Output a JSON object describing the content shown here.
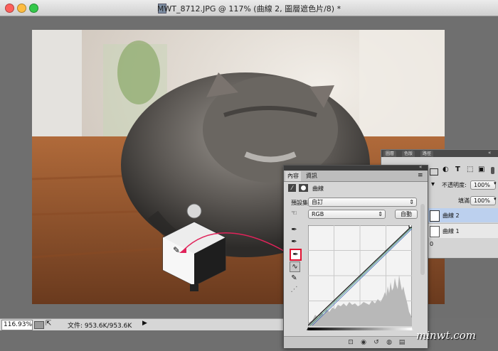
{
  "window": {
    "title": "MWT_8712.JPG @ 117% (曲線 2, 圖層遮色片/8) *"
  },
  "statusbar": {
    "zoom": "116.93%",
    "doc_info": "文件: 953.6K/953.6K"
  },
  "layers_panel": {
    "tabs": [
      "圖層",
      "色版",
      "路徑"
    ],
    "opacity_label": "不透明度:",
    "opacity_value": "100%",
    "fill_label": "填滿:",
    "fill_value": "100%",
    "layers": [
      {
        "name": "曲線 2",
        "selected": true
      },
      {
        "name": "曲線 1",
        "selected": false
      }
    ],
    "last_row": "0"
  },
  "properties_panel": {
    "tabs": [
      "內容",
      "資訊"
    ],
    "adjustment_title": "曲線",
    "preset_label": "預設集:",
    "preset_value": "自訂",
    "channel_value": "RGB",
    "auto_button": "自動"
  },
  "watermark": "minwt.com",
  "colors": {
    "selected_layer": "#bcd0ee",
    "highlight_box": "#e01030",
    "arrow": "#e0235a"
  }
}
